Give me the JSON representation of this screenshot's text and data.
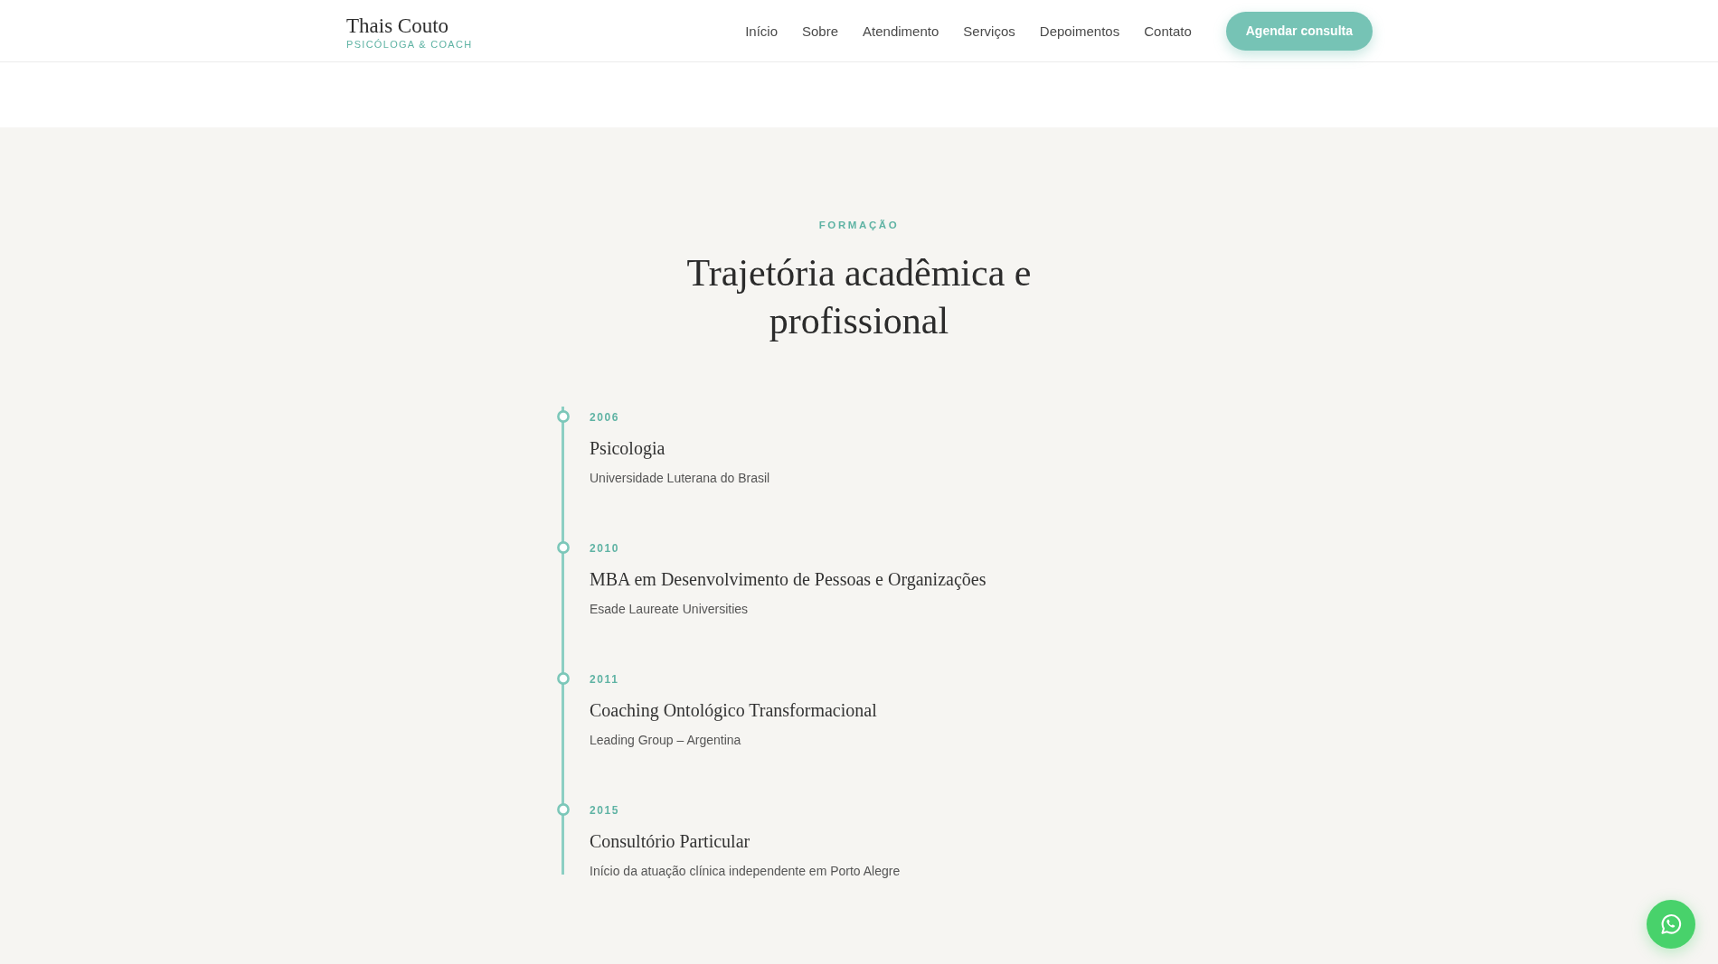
{
  "header": {
    "logo": {
      "name": "Thais Couto",
      "tagline": "PSICÓLOGA & COACH"
    },
    "nav": [
      "Início",
      "Sobre",
      "Atendimento",
      "Serviços",
      "Depoimentos",
      "Contato"
    ],
    "cta": "Agendar consulta"
  },
  "section": {
    "eyebrow": "FORMAÇÃO",
    "title": "Trajetória acadêmica e profissional",
    "timeline": [
      {
        "year": "2006",
        "title": "Psicologia",
        "institution": "Universidade Luterana do Brasil"
      },
      {
        "year": "2010",
        "title": "MBA em Desenvolvimento de Pessoas e Organizações",
        "institution": "Esade Laureate Universities"
      },
      {
        "year": "2011",
        "title": "Coaching Ontológico Transformacional",
        "institution": "Leading Group – Argentina"
      },
      {
        "year": "2015",
        "title": "Consultório Particular",
        "institution": "Início da atuação clínica independente em Porto Alegre"
      }
    ]
  }
}
